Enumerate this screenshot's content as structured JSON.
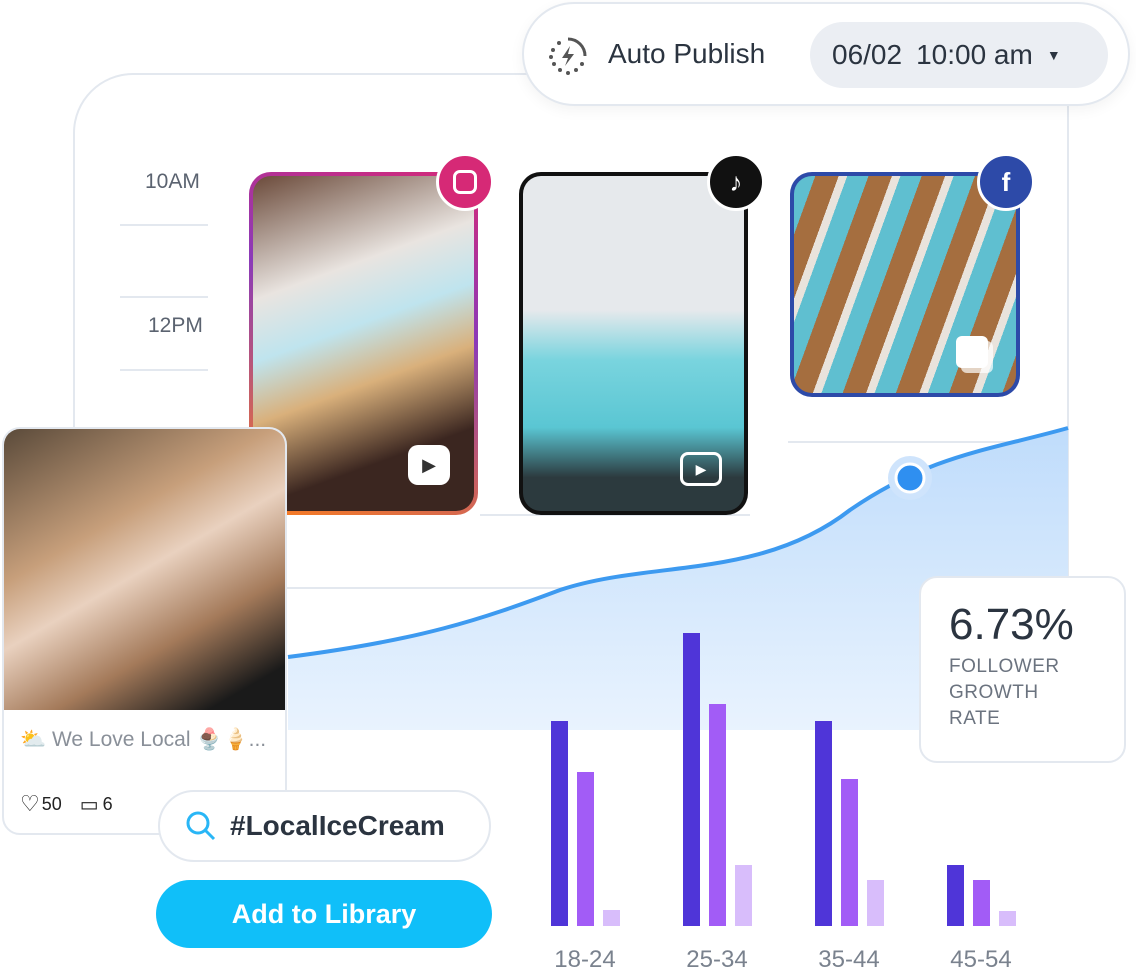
{
  "auto_publish": {
    "label": "Auto Publish",
    "icon": "auto-publish-bolt-icon",
    "date": "06/02",
    "time": "10:00 am"
  },
  "schedule": {
    "time_labels": [
      "10AM",
      "12PM"
    ]
  },
  "posts": [
    {
      "network": "instagram",
      "badge_color": "#d62976",
      "type_icon": "reels-icon"
    },
    {
      "network": "tiktok",
      "badge_color": "#111111",
      "type_icon": "video-icon"
    },
    {
      "network": "facebook",
      "badge_color": "#2d4aa8",
      "type_icon": "carousel-icon"
    }
  ],
  "growth": {
    "value": "6.73%",
    "label_lines": [
      "FOLLOWER",
      "GROWTH",
      "RATE"
    ]
  },
  "post_card": {
    "caption": "⛅ We Love Local 🍨🍦...",
    "likes": "50",
    "comments": "6"
  },
  "search": {
    "query": "#LocalIceCream"
  },
  "add_button": {
    "label": "Add to Library",
    "color": "#10bff9"
  },
  "chart_data": {
    "type": "bar",
    "categories": [
      "18-24",
      "25-34",
      "35-44",
      "45-54"
    ],
    "series": [
      {
        "values": [
          205,
          293,
          205,
          61
        ],
        "color": "#4f35d8"
      },
      {
        "values": [
          154,
          222,
          147,
          46
        ],
        "color": "#a25cf6"
      },
      {
        "values": [
          16,
          61,
          46,
          15
        ],
        "color": "#d8bdfb"
      }
    ],
    "grid": false
  }
}
